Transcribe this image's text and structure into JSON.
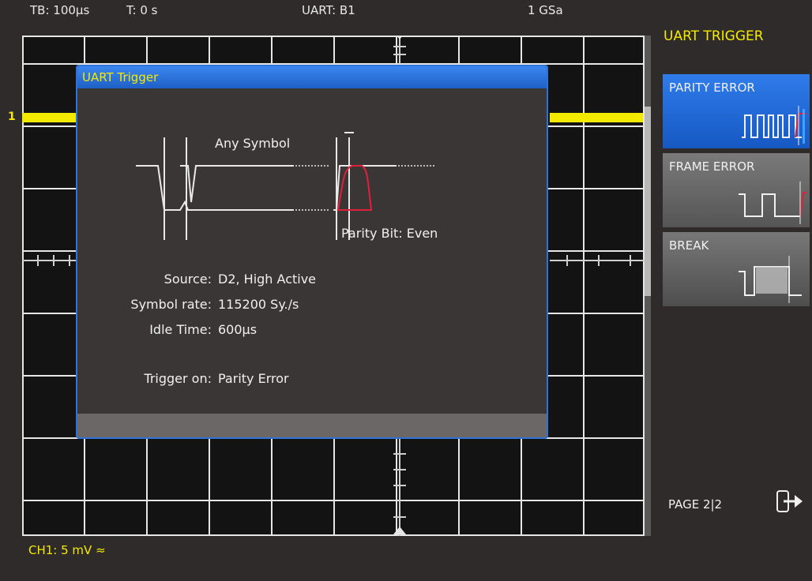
{
  "status_bar": {
    "timebase": "TB: 100µs",
    "trigger_time": "T: 0 s",
    "bus": "UART: B1",
    "sample_rate": "1 GSa"
  },
  "channel": {
    "marker": "1",
    "footer": "CH1: 5 mV ≈",
    "color": "#f4ea00"
  },
  "dialog": {
    "title": "UART Trigger",
    "any_symbol": "Any Symbol",
    "parity_label": "Parity Bit: Even",
    "fields": [
      {
        "key": "Source:",
        "value": "D2, High Active"
      },
      {
        "key": "Symbol rate:",
        "value": "115200 Sy./s"
      },
      {
        "key": "Idle Time:",
        "value": "600µs"
      },
      {
        "key": "Trigger on:",
        "value": "Parity Error"
      }
    ]
  },
  "menu": {
    "title": "UART TRIGGER",
    "softkeys": [
      {
        "label": "PARITY ERROR",
        "selected": true,
        "icon": "parity-error-waveform-icon"
      },
      {
        "label": "FRAME ERROR",
        "selected": false,
        "icon": "frame-error-waveform-icon"
      },
      {
        "label": "BREAK",
        "selected": false,
        "icon": "break-waveform-icon"
      }
    ],
    "page": "PAGE 2|2",
    "exit_icon": "exit-icon"
  },
  "colors": {
    "accent_blue": "#2f73d8",
    "trace_yellow": "#f4ea00",
    "parity_red": "#e0203a"
  }
}
